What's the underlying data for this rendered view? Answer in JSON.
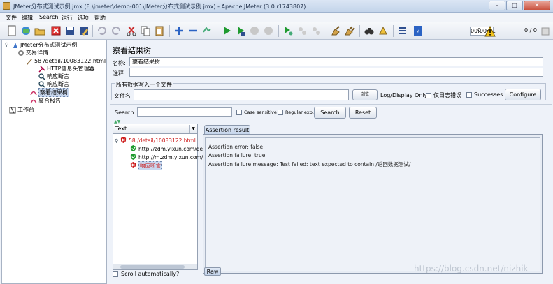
{
  "window": {
    "title": "JMeter分布式测试示例.jmx (E:\\jmeter\\demo-001\\JMeter分布式测试示例.jmx) - Apache JMeter (3.0 r1743807)",
    "buttons": {
      "minimize": "–",
      "maximize": "□",
      "close": "✕"
    }
  },
  "menu": [
    "文件",
    "编辑",
    "Search",
    "运行",
    "选项",
    "帮助"
  ],
  "toolbar": {
    "icons": [
      "new-icon",
      "templates-icon",
      "open-icon",
      "close-icon",
      "save-icon",
      "save-as-icon",
      "cut-icon",
      "copy-icon",
      "paste-icon",
      "expand-icon",
      "collapse-icon",
      "toggle-icon",
      "start-icon",
      "start-no-pause-icon",
      "stop-icon",
      "shutdown-icon",
      "remote-start-icon",
      "remote-stop-icon",
      "remote-shutdown-icon",
      "clear-icon",
      "clear-all-icon",
      "search-icon",
      "reset-search-icon",
      "function-helper-icon",
      "help-icon"
    ],
    "timer": "00:00:01",
    "warnings": "0",
    "threads": "0 / 0"
  },
  "tree": {
    "nodes": [
      {
        "label": "JMeter分布式测试示例",
        "icon": "test-plan-icon"
      },
      {
        "label": "交易详情",
        "icon": "thread-group-icon"
      },
      {
        "label": "58 /detail/10083122.html",
        "icon": "http-sampler-icon"
      },
      {
        "label": "HTTP信息头管理器",
        "icon": "header-manager-icon"
      },
      {
        "label": "响应断言",
        "icon": "assertion-icon"
      },
      {
        "label": "响应断言",
        "icon": "assertion-icon"
      },
      {
        "label": "察看结果树",
        "icon": "listener-icon",
        "selected": true
      },
      {
        "label": "聚合报告",
        "icon": "listener-icon"
      },
      {
        "label": "工作台",
        "icon": "workbench-icon"
      }
    ]
  },
  "panel": {
    "heading": "察看结果树",
    "name_label": "名称:",
    "name_value": "察看结果树",
    "comment_label": "注释:",
    "comment_value": "",
    "file_group_title": "所有数据写入一个文件",
    "file_label": "文件名",
    "file_value": "",
    "browse_label": "浏览",
    "log_display_label": "Log/Display Only:",
    "errors_only_label": "仅日志错误",
    "successes_label": "Successes",
    "configure_label": "Configure",
    "search_label": "Search:",
    "search_value": "",
    "case_sensitive_label": "Case sensitive",
    "regex_label": "Regular exp.",
    "search_button": "Search",
    "reset_button": "Reset"
  },
  "results": {
    "renderer": "Text",
    "items": [
      {
        "label": "58 /detail/10083122.html",
        "status": "fail"
      },
      {
        "label": "http://zdm.yixun.com/deta",
        "status": "pass"
      },
      {
        "label": "http://m.zdm.yixun.com/d",
        "status": "pass"
      },
      {
        "label": "响应断言",
        "status": "fail",
        "selected": true
      }
    ],
    "scroll_auto_label": "Scroll automatically?"
  },
  "detail": {
    "tab_label": "Assertion result",
    "lines": [
      "Assertion error: false",
      "Assertion failure: true",
      "Assertion failure message: Test failed: text expected to contain /返回数据测试/"
    ],
    "raw_tab": "Raw"
  },
  "watermark": "https://blog.csdn.net/nizhik",
  "colors": {
    "fail": "#cc1a1a",
    "pass": "#1e9a2e",
    "accent": "#c3d4ea"
  }
}
